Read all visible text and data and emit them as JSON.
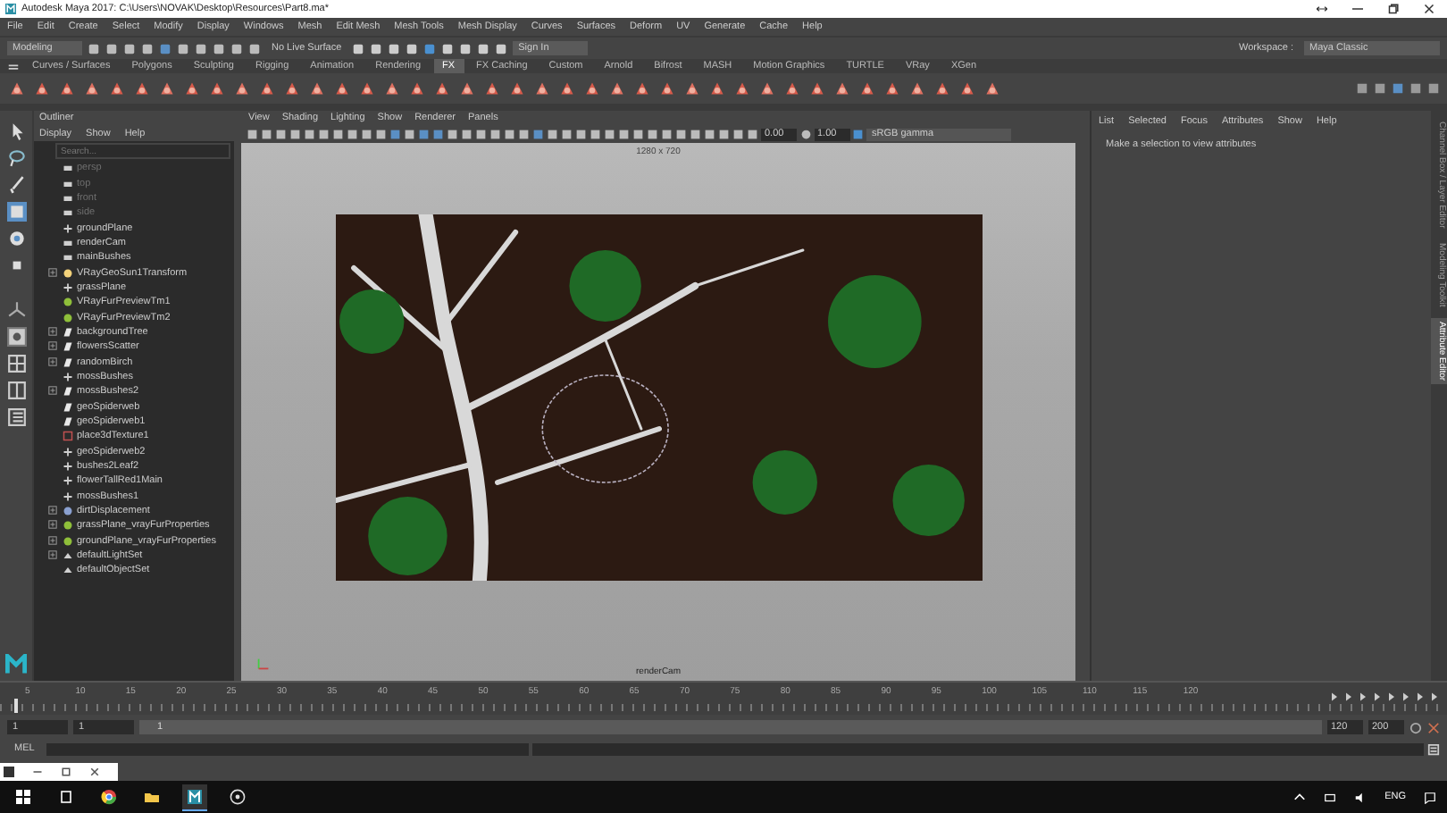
{
  "window": {
    "title": "Autodesk Maya 2017: C:\\Users\\NOVAK\\Desktop\\Resources\\Part8.ma*"
  },
  "menu": [
    "File",
    "Edit",
    "Create",
    "Select",
    "Modify",
    "Display",
    "Windows",
    "Mesh",
    "Edit Mesh",
    "Mesh Tools",
    "Mesh Display",
    "Curves",
    "Surfaces",
    "Deform",
    "UV",
    "Generate",
    "Cache",
    "Help"
  ],
  "status_line": {
    "menu_set": "Modeling",
    "live_surface": "No Live Surface",
    "sign_in": "Sign In",
    "workspace_label": "Workspace :",
    "workspace": "Maya Classic"
  },
  "shelf_tabs": [
    {
      "label": "Curves / Surfaces",
      "selected": false
    },
    {
      "label": "Polygons",
      "selected": false
    },
    {
      "label": "Sculpting",
      "selected": false
    },
    {
      "label": "Rigging",
      "selected": false
    },
    {
      "label": "Animation",
      "selected": false
    },
    {
      "label": "Rendering",
      "selected": false
    },
    {
      "label": "FX",
      "selected": true
    },
    {
      "label": "FX Caching",
      "selected": false
    },
    {
      "label": "Custom",
      "selected": false
    },
    {
      "label": "Arnold",
      "selected": false
    },
    {
      "label": "Bifrost",
      "selected": false
    },
    {
      "label": "MASH",
      "selected": false
    },
    {
      "label": "Motion Graphics",
      "selected": false
    },
    {
      "label": "TURTLE",
      "selected": false
    },
    {
      "label": "VRay",
      "selected": false
    },
    {
      "label": "XGen",
      "selected": false
    }
  ],
  "outliner": {
    "title": "Outliner",
    "menu": [
      "Display",
      "Show",
      "Help"
    ],
    "search": {
      "placeholder": "Search..."
    },
    "items": [
      {
        "label": "persp",
        "kind": "camera",
        "dimmed": true,
        "collapsed": false
      },
      {
        "label": "top",
        "kind": "camera",
        "dimmed": true,
        "collapsed": false
      },
      {
        "label": "front",
        "kind": "camera",
        "dimmed": true,
        "collapsed": false
      },
      {
        "label": "side",
        "kind": "camera",
        "dimmed": true,
        "collapsed": false
      },
      {
        "label": "groundPlane",
        "kind": "transform",
        "dimmed": false,
        "collapsed": false
      },
      {
        "label": "renderCam",
        "kind": "camera",
        "dimmed": false,
        "collapsed": false
      },
      {
        "label": "mainBushes",
        "kind": "camera",
        "dimmed": false,
        "collapsed": false
      },
      {
        "label": "VRayGeoSun1Transform",
        "kind": "sun",
        "dimmed": false,
        "collapsed": true
      },
      {
        "label": "grassPlane",
        "kind": "transform",
        "dimmed": false,
        "collapsed": false
      },
      {
        "label": "VRayFurPreviewTm1",
        "kind": "fur",
        "dimmed": false,
        "collapsed": false
      },
      {
        "label": "VRayFurPreviewTm2",
        "kind": "fur",
        "dimmed": false,
        "collapsed": false
      },
      {
        "label": "backgroundTree",
        "kind": "curve",
        "dimmed": false,
        "collapsed": true
      },
      {
        "label": "flowersScatter",
        "kind": "curve",
        "dimmed": false,
        "collapsed": true
      },
      {
        "label": "randomBirch",
        "kind": "curve",
        "dimmed": false,
        "collapsed": true
      },
      {
        "label": "mossBushes",
        "kind": "transform",
        "dimmed": false,
        "collapsed": false
      },
      {
        "label": "mossBushes2",
        "kind": "curve",
        "dimmed": false,
        "collapsed": true
      },
      {
        "label": "geoSpiderweb",
        "kind": "curve",
        "dimmed": false,
        "collapsed": false
      },
      {
        "label": "geoSpiderweb1",
        "kind": "curve",
        "dimmed": false,
        "collapsed": false
      },
      {
        "label": "place3dTexture1",
        "kind": "texture",
        "dimmed": false,
        "collapsed": false
      },
      {
        "label": "geoSpiderweb2",
        "kind": "transform",
        "dimmed": false,
        "collapsed": false
      },
      {
        "label": "bushes2Leaf2",
        "kind": "transform",
        "dimmed": false,
        "collapsed": false
      },
      {
        "label": "flowerTallRed1Main",
        "kind": "transform",
        "dimmed": false,
        "collapsed": false
      },
      {
        "label": "mossBushes1",
        "kind": "transform",
        "dimmed": false,
        "collapsed": false
      },
      {
        "label": "dirtDisplacement",
        "kind": "displacement",
        "dimmed": false,
        "collapsed": true
      },
      {
        "label": "grassPlane_vrayFurProperties",
        "kind": "fur",
        "dimmed": false,
        "collapsed": true
      },
      {
        "label": "groundPlane_vrayFurProperties",
        "kind": "fur",
        "dimmed": false,
        "collapsed": true
      },
      {
        "label": "defaultLightSet",
        "kind": "set",
        "dimmed": false,
        "collapsed": true
      },
      {
        "label": "defaultObjectSet",
        "kind": "set",
        "dimmed": false,
        "collapsed": false
      }
    ]
  },
  "viewport": {
    "menu": [
      "View",
      "Shading",
      "Lighting",
      "Show",
      "Renderer",
      "Panels"
    ],
    "exposure": "0.00",
    "gamma": "1.00",
    "color_space": "sRGB gamma",
    "resolution": "1280 x 720",
    "camera": "renderCam"
  },
  "attribute_editor": {
    "menu": [
      "List",
      "Selected",
      "Focus",
      "Attributes",
      "Show",
      "Help"
    ],
    "message": "Make a selection to view attributes"
  },
  "side_tabs": [
    {
      "label": "Channel Box / Layer Editor",
      "selected": false
    },
    {
      "label": "Modeling Toolkit",
      "selected": false
    },
    {
      "label": "Attribute Editor",
      "selected": true
    }
  ],
  "timeline": {
    "level": 0,
    "ticks": [
      "5",
      "10",
      "15",
      "20",
      "25",
      "30",
      "35",
      "40",
      "45",
      "50",
      "55",
      "60",
      "65",
      "70",
      "75",
      "80",
      "85",
      "90",
      "95",
      "100",
      "105",
      "110",
      "115",
      "120"
    ]
  },
  "range": {
    "level": 1,
    "start": "1",
    "playback_start": "1",
    "slider_label": "1",
    "playback_end": "120",
    "end": "200"
  },
  "command_line": {
    "label": "MEL"
  },
  "taskbar": {
    "language": "ENG"
  }
}
